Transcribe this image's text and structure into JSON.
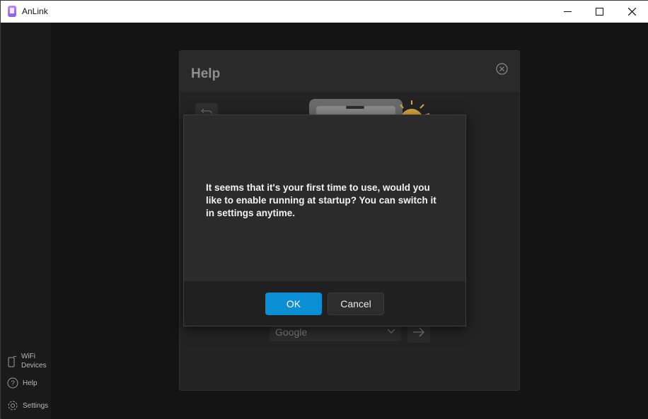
{
  "window": {
    "title": "AnLink"
  },
  "sidebar": {
    "items": [
      {
        "label": "WiFi\nDevices",
        "icon": "phone-wifi-icon"
      },
      {
        "label": "Help",
        "icon": "help-circle-icon"
      },
      {
        "label": "Settings",
        "icon": "gear-icon"
      }
    ]
  },
  "help": {
    "title": "Help",
    "language": {
      "selected": "Google"
    }
  },
  "dialog": {
    "message": "It seems that it's your first time to use, would you like to enable running at startup? You can switch it in settings anytime.",
    "ok_label": "OK",
    "cancel_label": "Cancel"
  },
  "colors": {
    "accent": "#0a8fd4",
    "background": "#141414",
    "dialog": "#2b2b2b"
  }
}
